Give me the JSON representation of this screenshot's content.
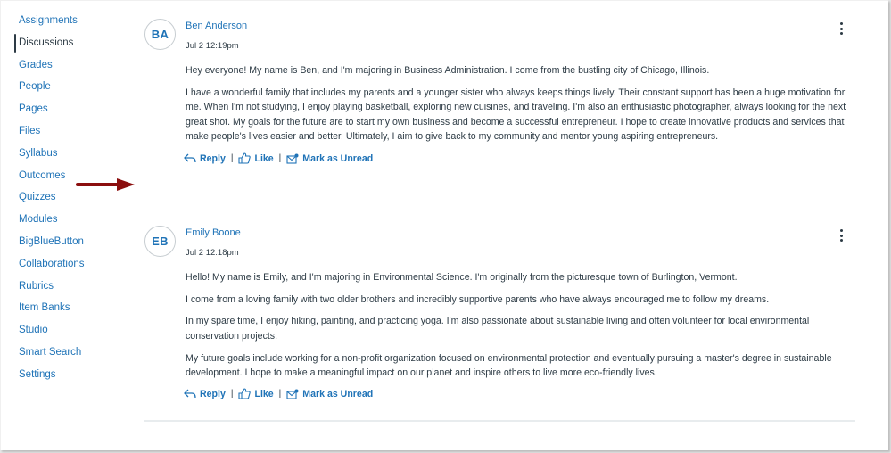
{
  "sidebar": {
    "items": [
      {
        "label": "Assignments",
        "active": false
      },
      {
        "label": "Discussions",
        "active": true
      },
      {
        "label": "Grades",
        "active": false
      },
      {
        "label": "People",
        "active": false
      },
      {
        "label": "Pages",
        "active": false
      },
      {
        "label": "Files",
        "active": false
      },
      {
        "label": "Syllabus",
        "active": false
      },
      {
        "label": "Outcomes",
        "active": false
      },
      {
        "label": "Quizzes",
        "active": false
      },
      {
        "label": "Modules",
        "active": false
      },
      {
        "label": "BigBlueButton",
        "active": false
      },
      {
        "label": "Collaborations",
        "active": false
      },
      {
        "label": "Rubrics",
        "active": false
      },
      {
        "label": "Item Banks",
        "active": false
      },
      {
        "label": "Studio",
        "active": false
      },
      {
        "label": "Smart Search",
        "active": false
      },
      {
        "label": "Settings",
        "active": false
      }
    ]
  },
  "annotation": {
    "icon": "arrow-right-icon",
    "color": "#8b0e0e"
  },
  "colors": {
    "link": "#1f73b7",
    "text": "#2d3b45",
    "divider": "#dfe4e5"
  },
  "entries": [
    {
      "initials": "BA",
      "author": "Ben Anderson",
      "timestamp": "Jul 2 12:19pm",
      "paragraphs": [
        "Hey everyone! My name is Ben, and I'm majoring in Business Administration. I come from the bustling city of Chicago, Illinois.",
        "I have a wonderful family that includes my parents and a younger sister who always keeps things lively. Their constant support has been a huge motivation for me. When I'm not studying, I enjoy playing basketball, exploring new cuisines, and traveling. I'm also an enthusiastic photographer, always looking for the next great shot. My goals for the future are to start my own business and become a successful entrepreneur. I hope to create innovative products and services that make people's lives easier and better. Ultimately, I aim to give back to my community and mentor young aspiring entrepreneurs."
      ],
      "actions": {
        "reply": "Reply",
        "like": "Like",
        "mark_unread": "Mark as Unread"
      },
      "menu_icon": "more-options-icon"
    },
    {
      "initials": "EB",
      "author": "Emily Boone",
      "timestamp": "Jul 2 12:18pm",
      "paragraphs": [
        "Hello! My name is Emily, and I'm majoring in Environmental Science. I'm originally from the picturesque town of Burlington, Vermont.",
        "I come from a loving family with two older brothers and incredibly supportive parents who have always encouraged me to follow my dreams.",
        "In my spare time, I enjoy hiking, painting, and practicing yoga. I'm also passionate about sustainable living and often volunteer for local environmental conservation projects.",
        "My future goals include working for a non-profit organization focused on environmental protection and eventually pursuing a master's degree in sustainable development. I hope to make a meaningful impact on our planet and inspire others to live more eco-friendly lives."
      ],
      "actions": {
        "reply": "Reply",
        "like": "Like",
        "mark_unread": "Mark as Unread"
      },
      "menu_icon": "more-options-icon"
    }
  ]
}
